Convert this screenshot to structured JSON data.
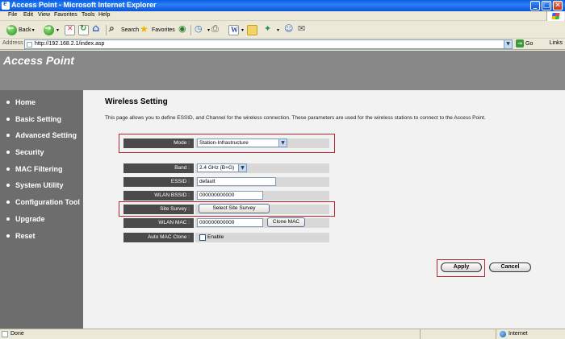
{
  "window": {
    "title": "Access Point - Microsoft Internet Explorer",
    "controls": [
      "_",
      "□",
      "✕"
    ]
  },
  "menu": [
    "File",
    "Edit",
    "View",
    "Favorites",
    "Tools",
    "Help"
  ],
  "toolbar": {
    "back": "Back",
    "search": "Search",
    "favorites": "Favorites"
  },
  "address": {
    "label": "Address",
    "url": "http://192.168.2.1/index.asp",
    "go": "Go",
    "links": "Links"
  },
  "banner": {
    "brand": "Access Point"
  },
  "sidebar": {
    "items": [
      {
        "label": "Home"
      },
      {
        "label": "Basic Setting"
      },
      {
        "label": "Advanced Setting"
      },
      {
        "label": "Security"
      },
      {
        "label": "MAC Filtering"
      },
      {
        "label": "System Utility"
      },
      {
        "label": "Configuration Tool"
      },
      {
        "label": "Upgrade"
      },
      {
        "label": "Reset"
      }
    ]
  },
  "main": {
    "title": "Wireless Setting",
    "description": "This page allows you to define ESSID, and Channel for the wireless connection. These parameters are used for the wireless stations to connect to the Access Point.",
    "mode_label": "Mode :",
    "mode_value": "Station-Infrastructure",
    "band_label": "Band :",
    "band_value": "2.4 GHz (B+G)",
    "essid_label": "ESSID :",
    "essid_value": "default",
    "wlan_bssid_label": "WLAN BSSID :",
    "wlan_bssid_value": "000000000000",
    "site_survey_label": "Site Survey :",
    "site_survey_button": "Select Site Survey",
    "wlan_mac_label": "WLAN MAC :",
    "wlan_mac_value": "000000000000",
    "clone_mac_button": "Clone MAC",
    "auto_mac_clone_label": "Auto MAC Clone :",
    "enable_label": "Enable",
    "enable_checked": false,
    "apply_button": "Apply",
    "cancel_button": "Cancel"
  },
  "status": {
    "text": "Done",
    "zone": "Internet"
  },
  "colors": {
    "banner": "#888888",
    "sidebar": "#6d6d6d",
    "label_bg": "#4a4a4a",
    "highlight": "#b3262d"
  }
}
